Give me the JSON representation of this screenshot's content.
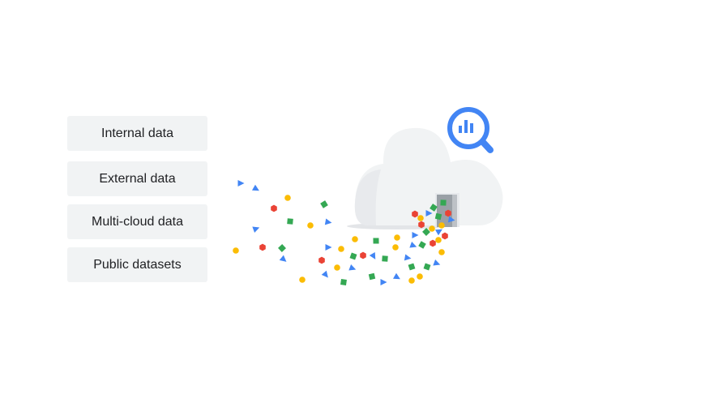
{
  "sources": [
    {
      "label": "Internal data"
    },
    {
      "label": "External data"
    },
    {
      "label": "Multi-cloud data"
    },
    {
      "label": "Public datasets"
    }
  ],
  "icons": {
    "cloud": "cloud-icon",
    "search": "bigquery-magnifier-icon",
    "door": "door-icon"
  },
  "colors": {
    "blue": "#4285f4",
    "red": "#ea4335",
    "yellow": "#fbbc04",
    "green": "#34a853",
    "box": "#f1f3f4",
    "cloud": "#f1f3f4"
  }
}
